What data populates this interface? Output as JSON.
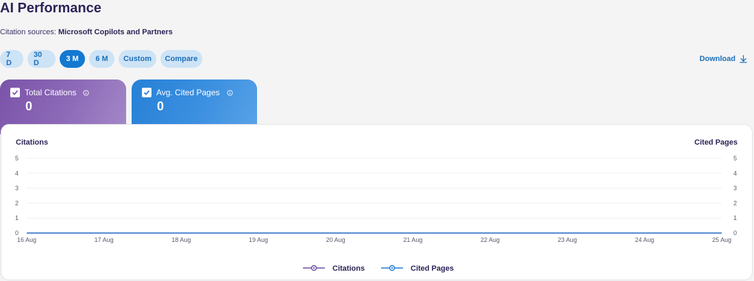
{
  "header": {
    "title": "AI Performance",
    "sources_label": "Citation sources:",
    "sources_value": "Microsoft Copilots and Partners"
  },
  "ranges": [
    {
      "label": "7 D",
      "active": false
    },
    {
      "label": "30 D",
      "active": false
    },
    {
      "label": "3 M",
      "active": true
    },
    {
      "label": "6 M",
      "active": false
    },
    {
      "label": "Custom",
      "active": false
    },
    {
      "label": "Compare",
      "active": false
    }
  ],
  "download_label": "Download",
  "cards": {
    "citations": {
      "label": "Total Citations",
      "value": "0",
      "checked": true
    },
    "pages": {
      "label": "Avg. Cited Pages",
      "value": "0",
      "checked": true
    }
  },
  "colors": {
    "citations": "#6b4fa3",
    "cited_pages": "#1f7ad2"
  },
  "chart_data": {
    "type": "line",
    "x": [
      "16 Aug",
      "17 Aug",
      "18 Aug",
      "19 Aug",
      "20 Aug",
      "21 Aug",
      "22 Aug",
      "23 Aug",
      "24 Aug",
      "25 Aug"
    ],
    "series": [
      {
        "name": "Citations",
        "values": [
          0,
          0,
          0,
          0,
          0,
          0,
          0,
          0,
          0,
          0
        ],
        "axis": "left"
      },
      {
        "name": "Cited Pages",
        "values": [
          0,
          0,
          0,
          0,
          0,
          0,
          0,
          0,
          0,
          0
        ],
        "axis": "right"
      }
    ],
    "ylabel_left": "Citations",
    "ylabel_right": "Cited Pages",
    "yticks": [
      0,
      1,
      2,
      3,
      4,
      5
    ],
    "ylim": [
      0,
      5
    ],
    "grid": true,
    "legend": "bottom-center"
  }
}
